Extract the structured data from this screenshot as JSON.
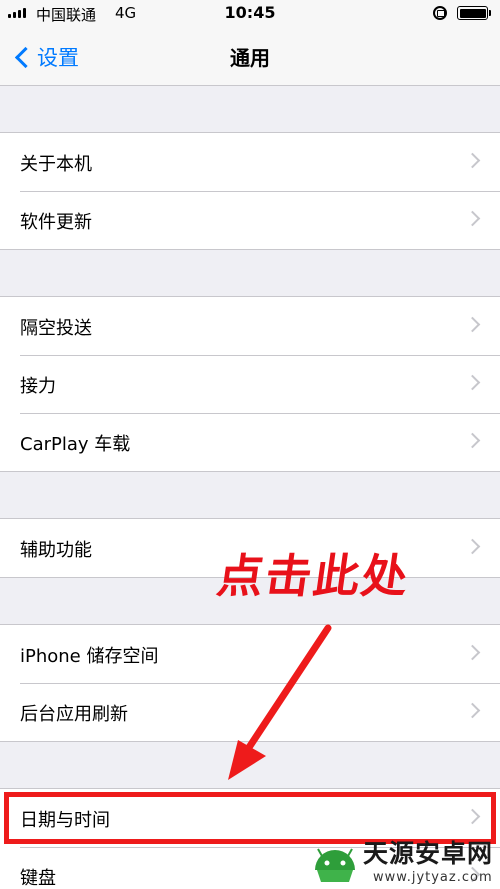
{
  "status_bar": {
    "carrier": "中国联通",
    "network": "4G",
    "time": "10:45",
    "battery_level": 1.0
  },
  "nav": {
    "back_label": "设置",
    "title": "通用"
  },
  "groups": [
    {
      "items": [
        {
          "label": "关于本机"
        },
        {
          "label": "软件更新"
        }
      ]
    },
    {
      "items": [
        {
          "label": "隔空投送"
        },
        {
          "label": "接力"
        },
        {
          "label": "CarPlay 车载"
        }
      ]
    },
    {
      "items": [
        {
          "label": "辅助功能"
        }
      ]
    },
    {
      "items": [
        {
          "label": "iPhone 储存空间"
        },
        {
          "label": "后台应用刷新"
        }
      ]
    },
    {
      "items": [
        {
          "label": "日期与时间"
        },
        {
          "label": "键盘"
        }
      ]
    }
  ],
  "annotation": {
    "text": "点击此处",
    "color": "#e8111a"
  },
  "watermark": {
    "name": "天源安卓网",
    "url": "www.jytyaz.com"
  },
  "colors": {
    "accent": "#007aff",
    "background": "#efeff4",
    "highlight": "#ee1b1b"
  }
}
